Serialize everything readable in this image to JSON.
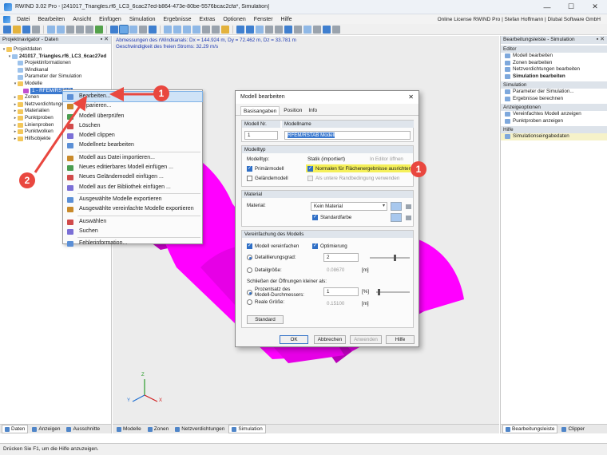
{
  "window": {
    "title": "RWIND 3.02 Pro - [241017_Triangles.rf6_LC3_6cac27ed-b864-473e-80be-5576bcac2cfa*, Simulation]",
    "minimize": "—",
    "maximize": "☐",
    "close": "✕"
  },
  "menu": {
    "items": [
      "Datei",
      "Bearbeiten",
      "Ansicht",
      "Einfügen",
      "Simulation",
      "Ergebnisse",
      "Extras",
      "Optionen",
      "Fenster",
      "Hilfe"
    ],
    "license": "Online License RWIND Pro | Stefan Hoffmann | Dlubal Software GmbH"
  },
  "left_panel": {
    "title": "Projektnavigator - Daten",
    "pin": "▪ ✕",
    "tree": [
      {
        "label": "Projektdaten",
        "indent": 0,
        "expander": "▾",
        "icon": "folder"
      },
      {
        "label": "241017_Triangles.rf6_LC3_6cac27ed",
        "indent": 1,
        "expander": "▾",
        "icon": "doc",
        "bold": true
      },
      {
        "label": "Projektinformationen",
        "indent": 2,
        "expander": "",
        "icon": "doc"
      },
      {
        "label": "Windkanal",
        "indent": 2,
        "expander": "",
        "icon": "doc"
      },
      {
        "label": "Parameter der Simulation",
        "indent": 2,
        "expander": "",
        "icon": "doc"
      },
      {
        "label": "Modelle",
        "indent": 2,
        "expander": "▾",
        "icon": "folder"
      },
      {
        "label": "1 - RFEM/RSTAB",
        "indent": 3,
        "expander": "",
        "icon": "model",
        "selected": true
      },
      {
        "label": "Zonen",
        "indent": 2,
        "expander": "▸",
        "icon": "folder"
      },
      {
        "label": "Netzverdichtungen",
        "indent": 2,
        "expander": "▸",
        "icon": "folder"
      },
      {
        "label": "Materialien",
        "indent": 2,
        "expander": "▸",
        "icon": "folder"
      },
      {
        "label": "Punktproben",
        "indent": 2,
        "expander": "▸",
        "icon": "folder"
      },
      {
        "label": "Linienproben",
        "indent": 2,
        "expander": "▸",
        "icon": "folder"
      },
      {
        "label": "Punktwolken",
        "indent": 2,
        "expander": "▸",
        "icon": "folder"
      },
      {
        "label": "Hilfsobjekte",
        "indent": 2,
        "expander": "▸",
        "icon": "folder"
      }
    ],
    "bottom_tabs": [
      "Daten",
      "Anzeigen",
      "Ausschnitte"
    ]
  },
  "viewport": {
    "info_line1": "Abmessungen des rWindkanals: Dx = 144.924 m, Dy = 72.462 m, Dz = 33.781 m",
    "info_line2": "Geschwindigkeit des freien Stroms: 32.29 m/s",
    "model_color": "#ff00ff",
    "axis_labels": {
      "z": "Z",
      "y": "Y",
      "x": "X"
    },
    "tabs": [
      "Modelle",
      "Zonen",
      "Netzverdichtungen",
      "Simulation"
    ]
  },
  "context_menu": {
    "items": [
      {
        "label": "Bearbeiten...",
        "hover": true
      },
      {
        "label": "Reparieren..."
      },
      {
        "label": "Modell überprüfen"
      },
      {
        "label": "Löschen"
      },
      {
        "label": "Modell clippen"
      },
      {
        "label": "Modellnetz bearbeiten"
      },
      {
        "sep": true
      },
      {
        "label": "Modell aus Datei importieren..."
      },
      {
        "label": "Neues editierbares Modell einfügen ..."
      },
      {
        "label": "Neues Geländemodell einfügen ..."
      },
      {
        "label": "Modell aus der Bibliothek einfügen ..."
      },
      {
        "sep": true
      },
      {
        "label": "Ausgewählte Modelle exportieren"
      },
      {
        "label": "Ausgewählte vereinfachte Modelle exportieren"
      },
      {
        "sep": true
      },
      {
        "label": "Auswählen"
      },
      {
        "label": "Suchen"
      },
      {
        "sep": true
      },
      {
        "label": "Fehlerinformation..."
      }
    ]
  },
  "dialog": {
    "title": "Modell bearbeiten",
    "close": "✕",
    "tabs": [
      "Basisangaben",
      "Position",
      "Info"
    ],
    "nr_label": "Modell Nr.",
    "nr_value": "1",
    "name_label": "Modellname",
    "name_value": "RFEM/RSTAB Modell",
    "group_typ": "Modelltyp",
    "modelltyp_label": "Modelltyp:",
    "statik_label": "Statik (importiert)",
    "in_editor_label": "In Editor öffnen",
    "primaermodell_label": "Primärmodell",
    "gelaendemodell_label": "Geländemodell",
    "normalen_label": "Normalen für Flächenergebnisse ausrichten",
    "randbedingung_label": "Als untere Randbedingung verwenden",
    "group_material": "Material",
    "material_label": "Material:",
    "material_value": "Kein Material",
    "standardfarbe_label": "Standardfarbe",
    "group_vereinfachung": "Vereinfachung des Modells",
    "vereinfachen_label": "Modell vereinfachen",
    "optimierung_label": "Optimierung",
    "detailgrad_label": "Detaillierungsgrad:",
    "detailgrad_value": "2",
    "detailgroesse_label": "Detailgröße:",
    "detailgroesse_value": "0.08670",
    "unit_m": "[m]",
    "oeffnungen_label": "Schließen der Öffnungen kleiner als:",
    "prozent_label_1": "Prozentsatz des",
    "prozent_label_2": "Modell-Durchmessers:",
    "prozent_value": "1",
    "unit_percent": "[%]",
    "reale_label": "Reale Größe:",
    "reale_value": "0.15100",
    "standard_button": "Standard",
    "ok_button": "OK",
    "abbrechen_button": "Abbrechen",
    "anwenden_button": "Anwenden",
    "hilfe_button": "Hilfe"
  },
  "right_panel": {
    "title": "Bearbeitungsleiste - Simulation",
    "pin": "▪ ✕",
    "sections": [
      {
        "title": "Editor",
        "items": [
          {
            "label": "Modell bearbeiten"
          },
          {
            "label": "Zonen bearbeiten"
          },
          {
            "label": "Netzverdichtungen bearbeiten"
          },
          {
            "label": "Simulation bearbeiten",
            "bold": true
          }
        ]
      },
      {
        "title": "Simulation",
        "items": [
          {
            "label": "Parameter der Simulation..."
          },
          {
            "label": "Ergebnisse berechnen"
          }
        ]
      },
      {
        "title": "Anzeigeoptionen",
        "items": [
          {
            "label": "Vereinfachtes Modell anzeigen"
          },
          {
            "label": "Punktproben anzeigen"
          }
        ]
      },
      {
        "title": "Hilfe",
        "items": [
          {
            "label": "Simulationseingabedaten",
            "highlight": true
          }
        ]
      }
    ],
    "bottom_tabs": [
      "Bearbeitungsleiste",
      "Clipper"
    ]
  },
  "status": {
    "text": "Drücken Sie F1, um die Hilfe anzuzeigen."
  },
  "callouts": {
    "one": "1",
    "two": "2",
    "three": "1"
  },
  "colors": {
    "accent": "#3b79cf",
    "callout": "#e9473f",
    "highlight": "#f5f05a"
  }
}
